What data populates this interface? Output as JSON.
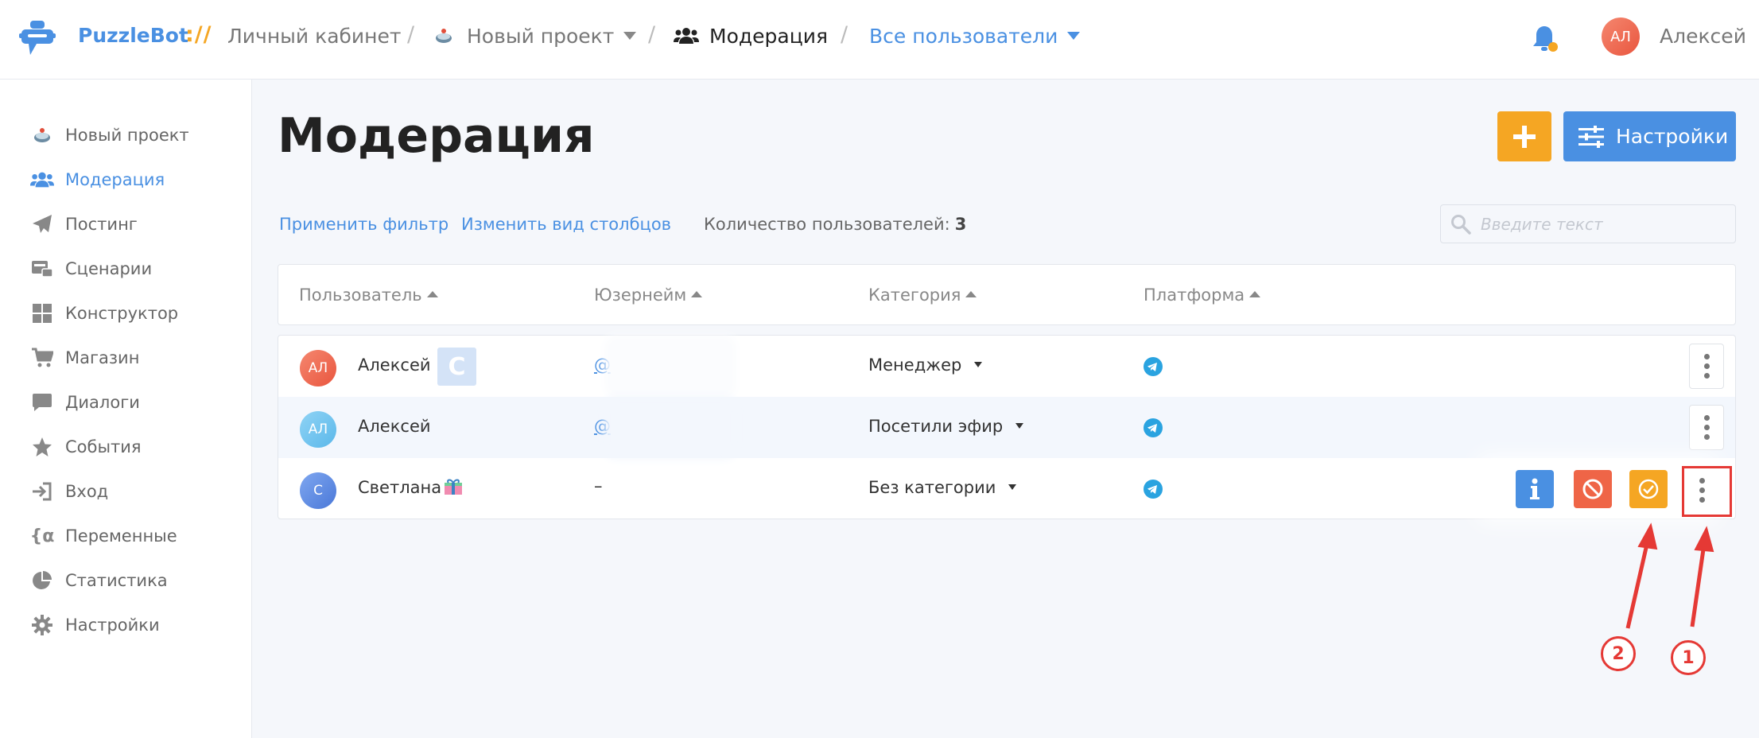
{
  "header": {
    "brand": "PuzzleBot",
    "brand_sep": "://",
    "crumbs": [
      "Личный кабинет",
      "Новый проект",
      "Модерация",
      "Все пользователи"
    ],
    "user_initials": "АЛ",
    "user_name": "Алексей"
  },
  "sidebar": {
    "items": [
      {
        "label": "Новый проект",
        "icon": "project-icon"
      },
      {
        "label": "Модерация",
        "icon": "users-icon",
        "active": true
      },
      {
        "label": "Постинг",
        "icon": "paper-plane-icon"
      },
      {
        "label": "Сценарии",
        "icon": "scenarios-icon"
      },
      {
        "label": "Конструктор",
        "icon": "grid-icon"
      },
      {
        "label": "Магазин",
        "icon": "cart-icon"
      },
      {
        "label": "Диалоги",
        "icon": "chat-icon"
      },
      {
        "label": "События",
        "icon": "star-icon"
      },
      {
        "label": "Вход",
        "icon": "login-icon"
      },
      {
        "label": "Переменные",
        "icon": "variable-icon"
      },
      {
        "label": "Статистика",
        "icon": "pie-chart-icon"
      },
      {
        "label": "Настройки",
        "icon": "gear-icon"
      }
    ]
  },
  "main": {
    "title": "Модерация",
    "settings_label": "Настройки",
    "apply_filter": "Применить фильтр",
    "change_columns": "Изменить вид столбцов",
    "count_label": "Количество пользователей:",
    "count_value": "3",
    "search_placeholder": "Введите текст"
  },
  "table": {
    "columns": [
      "Пользователь",
      "Юзернейм",
      "Категория",
      "Платформа"
    ],
    "rows": [
      {
        "initials": "АЛ",
        "name": "Алексей",
        "badge": "С",
        "username": "@",
        "category": "Менеджер",
        "platform": "telegram-icon"
      },
      {
        "initials": "АЛ",
        "name": "Алексей",
        "username": "@",
        "category": "Посетили эфир",
        "platform": "telegram-icon"
      },
      {
        "initials": "С",
        "name": "Светлана",
        "username": "–",
        "category": "Без категории",
        "platform": "telegram-icon"
      }
    ]
  },
  "annotations": [
    "2",
    "1"
  ],
  "colors": {
    "accent": "#4a90e2",
    "orange": "#f5a623",
    "red": "#ef6547",
    "annotation": "#e53935"
  }
}
